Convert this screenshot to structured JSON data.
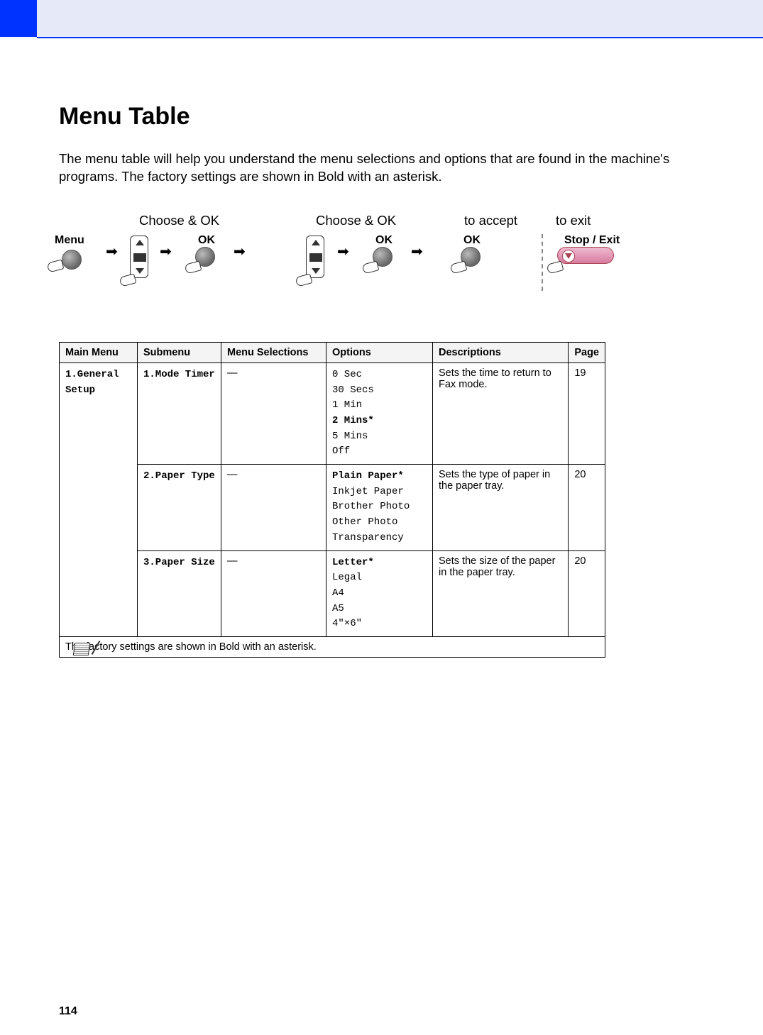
{
  "page": {
    "number": "114",
    "title": "Menu Table",
    "intro": "The menu table will help you understand the menu selections and options that are found in the machine's programs. The factory settings are shown in Bold with an asterisk."
  },
  "diagram": {
    "menu_label": "Menu",
    "choose_ok_1": "Choose & OK",
    "choose_ok_2": "Choose & OK",
    "to_accept": "to accept",
    "to_exit": "to exit",
    "ok_label_1": "OK",
    "ok_label_2": "OK",
    "ok_label_3": "OK",
    "stop_exit_label": "Stop / Exit"
  },
  "table": {
    "headers": {
      "main_menu": "Main Menu",
      "submenu": "Submenu",
      "selections": "Menu Selections",
      "options": "Options",
      "descriptions": "Descriptions",
      "page": "Page"
    },
    "main_menu": "1.General Setup",
    "rows": [
      {
        "submenu": "1.Mode Timer",
        "selections": "—",
        "options": [
          {
            "text": "0 Sec",
            "bold": false
          },
          {
            "text": "30 Secs",
            "bold": false
          },
          {
            "text": "1 Min",
            "bold": false
          },
          {
            "text": "2 Mins*",
            "bold": true
          },
          {
            "text": "5 Mins",
            "bold": false
          },
          {
            "text": "Off",
            "bold": false
          }
        ],
        "description": "Sets the time to return to Fax mode.",
        "page": "19"
      },
      {
        "submenu": "2.Paper Type",
        "selections": "—",
        "options": [
          {
            "text": "Plain Paper*",
            "bold": true
          },
          {
            "text": "Inkjet Paper",
            "bold": false
          },
          {
            "text": "Brother Photo",
            "bold": false
          },
          {
            "text": "Other Photo",
            "bold": false
          },
          {
            "text": "Transparency",
            "bold": false
          }
        ],
        "description": "Sets the type of paper in the paper tray.",
        "page": "20"
      },
      {
        "submenu": "3.Paper Size",
        "selections": "—",
        "options": [
          {
            "text": "Letter*",
            "bold": true
          },
          {
            "text": "Legal",
            "bold": false
          },
          {
            "text": "A4",
            "bold": false
          },
          {
            "text": "A5",
            "bold": false
          },
          {
            "text": "4\"×6\"",
            "bold": false
          }
        ],
        "description": "Sets the size of the paper in the paper tray.",
        "page": "20"
      }
    ],
    "footnote": "The factory settings are shown in Bold with an asterisk."
  }
}
